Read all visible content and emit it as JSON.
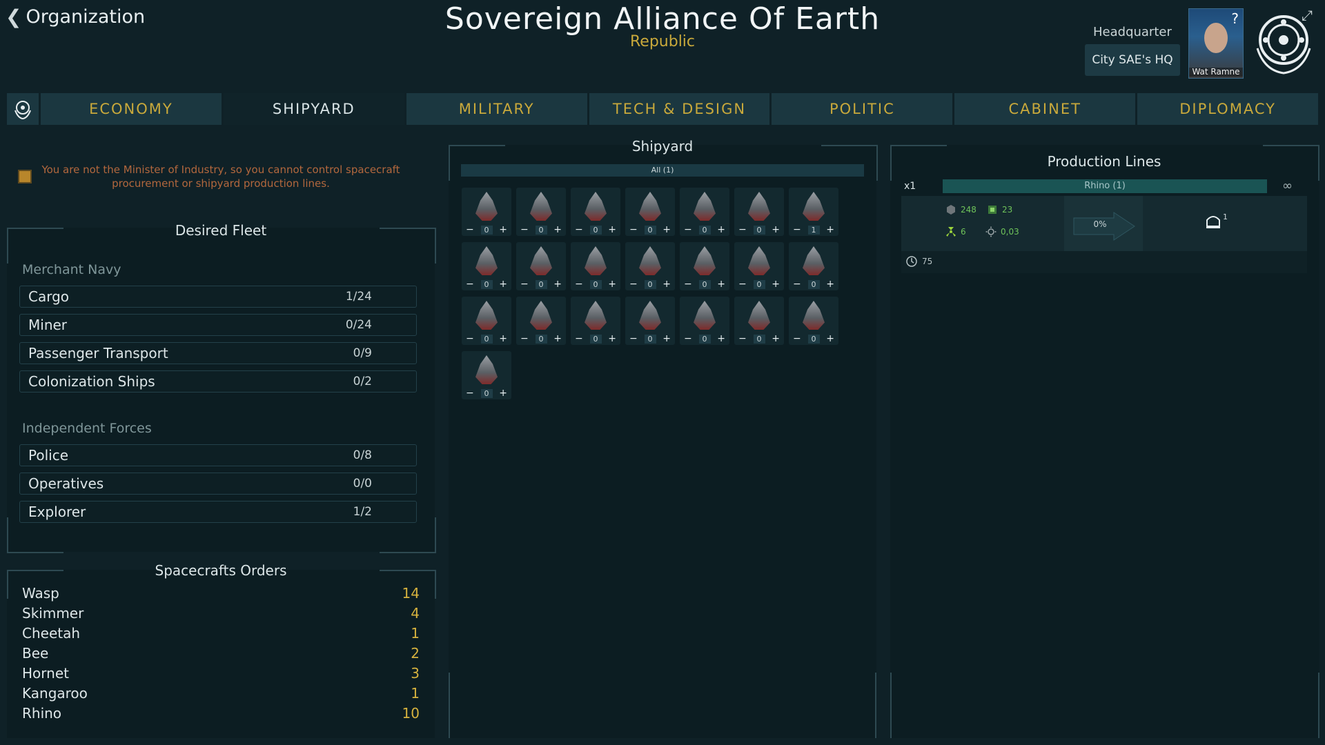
{
  "header": {
    "back_label": "Organization",
    "title": "Sovereign Alliance Of Earth",
    "subtitle": "Republic",
    "hq_label": "Headquarter",
    "hq_city": "City SAE's HQ",
    "leader_name": "Wat Ramne",
    "help_glyph": "?"
  },
  "tabs": [
    {
      "label": "ECONOMY",
      "active": false
    },
    {
      "label": "SHIPYARD",
      "active": true
    },
    {
      "label": "MILITARY",
      "active": false
    },
    {
      "label": "TECH & DESIGN",
      "active": false
    },
    {
      "label": "POLITIC",
      "active": false
    },
    {
      "label": "CABINET",
      "active": false
    },
    {
      "label": "DIPLOMACY",
      "active": false
    }
  ],
  "left": {
    "notice": "You are not the Minister of Industry, so you cannot control spacecraft procurement or shipyard production lines.",
    "desired_title": "Desired Fleet",
    "merchant_label": "Merchant Navy",
    "merchant": [
      {
        "name": "Cargo",
        "value": "1/24"
      },
      {
        "name": "Miner",
        "value": "0/24"
      },
      {
        "name": "Passenger Transport",
        "value": "0/9"
      },
      {
        "name": "Colonization Ships",
        "value": "0/2"
      }
    ],
    "independent_label": "Independent Forces",
    "independent": [
      {
        "name": "Police",
        "value": "0/8"
      },
      {
        "name": "Operatives",
        "value": "0/0"
      },
      {
        "name": "Explorer",
        "value": "1/2"
      }
    ],
    "orders_title": "Spacecrafts Orders",
    "orders": [
      {
        "name": "Wasp",
        "value": "14"
      },
      {
        "name": "Skimmer",
        "value": "4"
      },
      {
        "name": "Cheetah",
        "value": "1"
      },
      {
        "name": "Bee",
        "value": "2"
      },
      {
        "name": "Hornet",
        "value": "3"
      },
      {
        "name": "Kangaroo",
        "value": "1"
      },
      {
        "name": "Rhino",
        "value": "10"
      }
    ]
  },
  "shipyard": {
    "title": "Shipyard",
    "filter": "All (1)",
    "minus": "−",
    "plus": "+",
    "ships": [
      "0",
      "0",
      "0",
      "0",
      "0",
      "0",
      "1",
      "0",
      "0",
      "0",
      "0",
      "0",
      "0",
      "0",
      "0",
      "0",
      "0",
      "0",
      "0",
      "0",
      "0",
      "0"
    ]
  },
  "production": {
    "title": "Production Lines",
    "qty": "x1",
    "item": "Rhino (1)",
    "repeat": "∞",
    "res1": "248",
    "res2": "23",
    "res3": "6",
    "res4": "0,03",
    "progress": "0%",
    "output": "1",
    "time": "75"
  },
  "colors": {
    "accent_gold": "#c9a93b",
    "warning": "#b2673d",
    "resource_green": "#6fc35a",
    "background": "#0f2127"
  }
}
